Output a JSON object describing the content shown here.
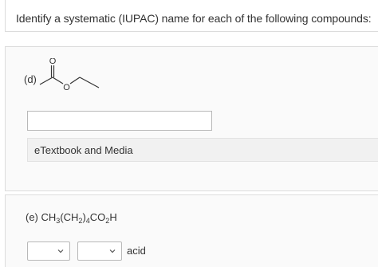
{
  "question": {
    "prompt": "Identify a systematic (IUPAC) name for each of the following compounds:"
  },
  "part_d": {
    "label": "(d)",
    "structure": {
      "carbonyl_oxygen": "O",
      "ester_oxygen": "O"
    },
    "answer_value": "",
    "etextbook_label": "eTextbook and Media"
  },
  "part_e": {
    "label": "(e)",
    "formula": [
      {
        "text": "CH",
        "sub": false
      },
      {
        "text": "3",
        "sub": true
      },
      {
        "text": "(CH",
        "sub": false
      },
      {
        "text": "2",
        "sub": true
      },
      {
        "text": ")",
        "sub": false
      },
      {
        "text": "4",
        "sub": true
      },
      {
        "text": "CO",
        "sub": false
      },
      {
        "text": "2",
        "sub": true
      },
      {
        "text": "H",
        "sub": false
      }
    ],
    "select_1_value": "",
    "select_2_value": "",
    "suffix": "acid"
  }
}
